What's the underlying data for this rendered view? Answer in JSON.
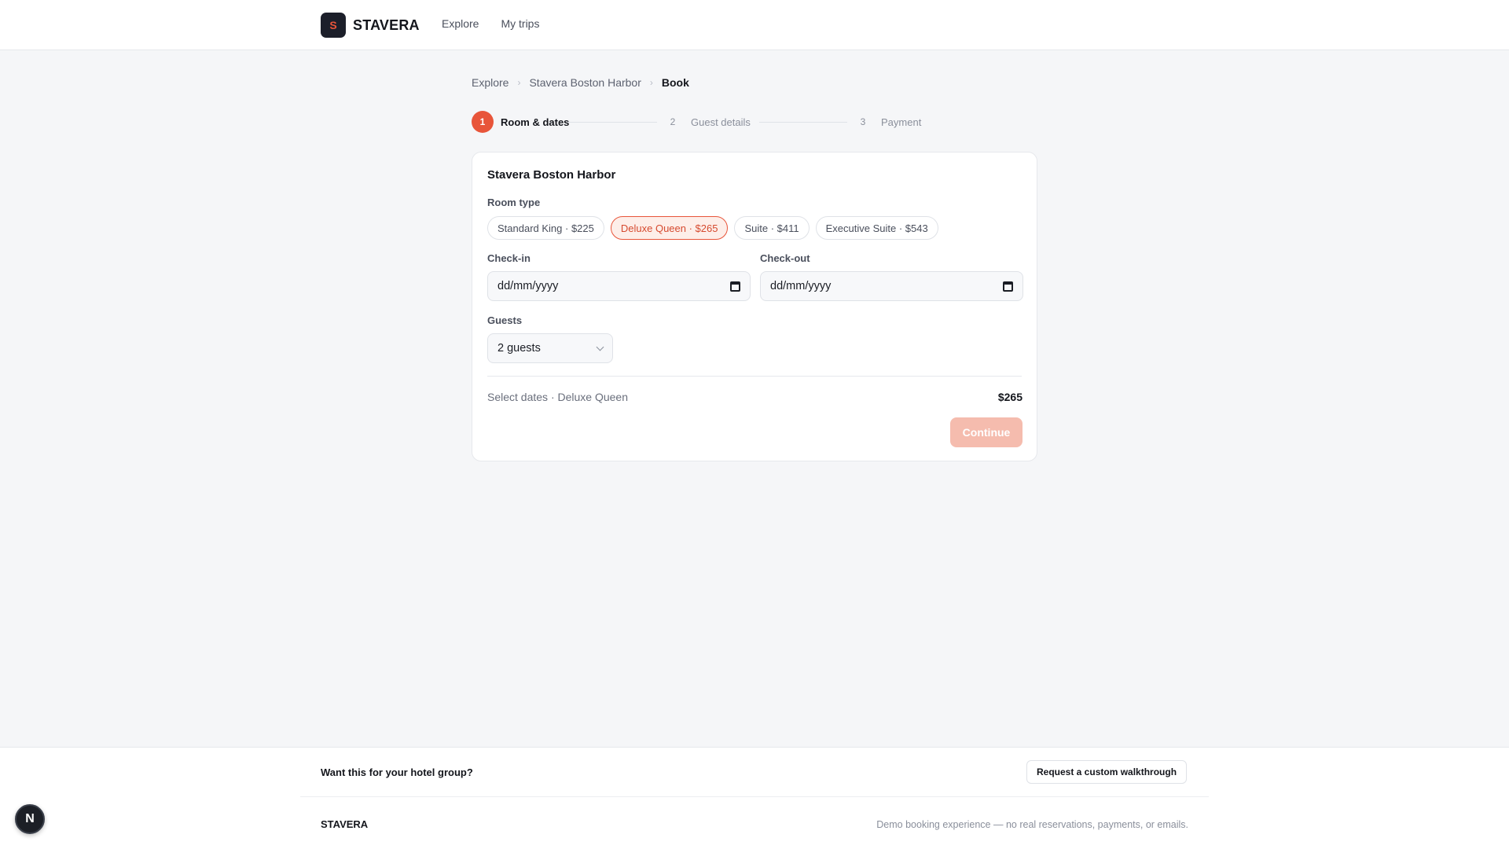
{
  "brand": {
    "mark": "S",
    "name": "STAVERA"
  },
  "nav": {
    "items": [
      "Explore",
      "My trips"
    ]
  },
  "breadcrumb": {
    "items": [
      "Explore",
      "Stavera Boston Harbor"
    ],
    "current": "Book"
  },
  "stepper": {
    "steps": [
      {
        "num": "1",
        "label": "Room & dates",
        "state": "active"
      },
      {
        "num": "2",
        "label": "Guest details",
        "state": "pending"
      },
      {
        "num": "3",
        "label": "Payment",
        "state": "pending"
      }
    ]
  },
  "booking": {
    "hotel_name": "Stavera Boston Harbor",
    "room_type_label": "Room type",
    "room_types": [
      {
        "label": "Standard King · $225",
        "selected": false
      },
      {
        "label": "Deluxe Queen · $265",
        "selected": true
      },
      {
        "label": "Suite · $411",
        "selected": false
      },
      {
        "label": "Executive Suite · $543",
        "selected": false
      }
    ],
    "checkin_label": "Check-in",
    "checkin_placeholder": "dd/mm/yyyy",
    "checkout_label": "Check-out",
    "checkout_placeholder": "dd/mm/yyyy",
    "guests_label": "Guests",
    "guests_value": "2 guests",
    "summary": "Select dates · Deluxe Queen",
    "total": "$265",
    "continue_label": "Continue"
  },
  "footer": {
    "cta_text": "Want this for your hotel group?",
    "cta_button": "Request a custom walkthrough",
    "brand": "STAVERA",
    "note": "Demo booking experience — no real reservations, payments, or emails."
  },
  "dev_badge": "N",
  "colors": {
    "accent": "#e8553a",
    "accent_disabled": "#f5bcae",
    "background": "#f5f6f8"
  }
}
